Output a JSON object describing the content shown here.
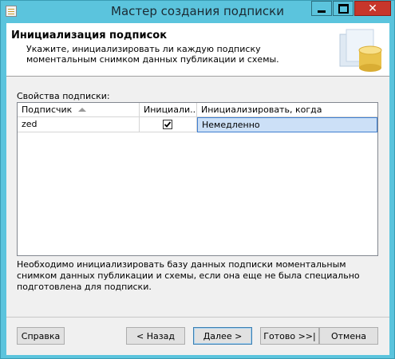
{
  "window": {
    "title": "Мастер создания подписки",
    "controls": {
      "minimize": "minimize",
      "maximize": "maximize",
      "close": "✕"
    }
  },
  "header": {
    "title": "Инициализация подписок",
    "subtitle": "Укажите, инициализировать ли каждую подписку моментальным снимком данных публикации и схемы."
  },
  "properties": {
    "label": "Свойства подписки:",
    "columns": [
      "Подписчик",
      "Инициали...",
      "Инициализировать, когда"
    ],
    "sort_column": "Подписчик",
    "rows": [
      {
        "subscriber": "zed",
        "initialize": true,
        "when": "Немедленно"
      }
    ]
  },
  "note": "Необходимо инициализировать базу данных подписки моментальным снимком данных публикации и схемы, если она еще не была специально подготовлена для подписки.",
  "buttons": {
    "help": "Справка",
    "back": "< Назад",
    "next": "Далее >",
    "finish": "Готово >>|",
    "cancel": "Отмена"
  },
  "colors": {
    "chrome": "#5bc4dd",
    "close": "#c7362b",
    "selection": "#cce0f7"
  }
}
